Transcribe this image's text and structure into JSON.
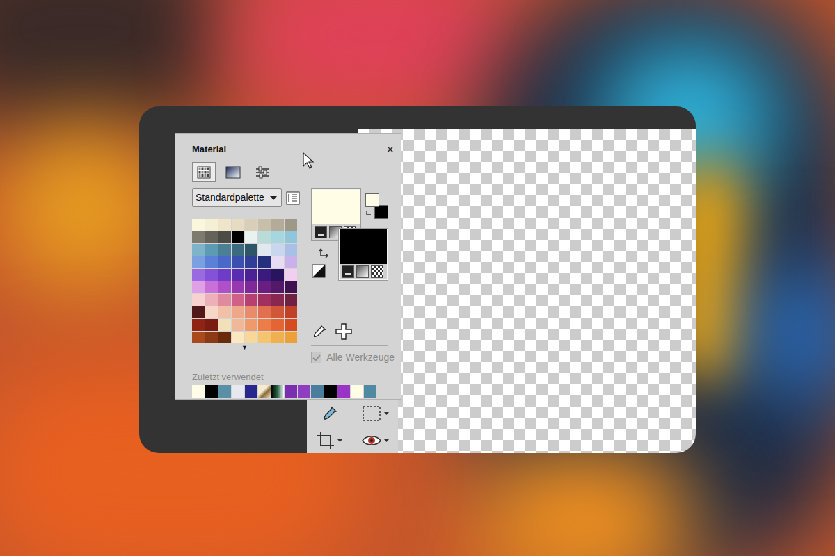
{
  "window": {
    "title": "Material",
    "close": "×"
  },
  "tabs": [
    {
      "kind": "swatches",
      "selected": true
    },
    {
      "kind": "gradient",
      "selected": false
    },
    {
      "kind": "properties",
      "selected": false
    }
  ],
  "palette": {
    "name": "Standardpalette",
    "scroll": "▼",
    "colors": [
      "#fbf7df",
      "#f5efd6",
      "#efe6c9",
      "#e6dcc2",
      "#d9cfb8",
      "#c8bfaa",
      "#b4ab98",
      "#9e9888",
      "#7e7a6e",
      "#65625a",
      "#4d4b46",
      "#000000",
      "#e8f2ee",
      "#b9dcd9",
      "#a6d7e0",
      "#8fc6dc",
      "#7fb3c9",
      "#5d9ab3",
      "#4a7f96",
      "#3c6a80",
      "#2f5568",
      "#e2e8f0",
      "#c8d6ee",
      "#a8c0e8",
      "#7aa0e0",
      "#5a80d8",
      "#4a68c8",
      "#3a50b0",
      "#2f3f98",
      "#24307c",
      "#e8dcf2",
      "#c9b2ec",
      "#9a6ae0",
      "#8452d8",
      "#6f3cc8",
      "#5a2cb0",
      "#4a2296",
      "#3a1a7c",
      "#2a1460",
      "#f0d0ee",
      "#e0a0e8",
      "#c870d8",
      "#b050c8",
      "#9838b0",
      "#802898",
      "#6a1e80",
      "#541868",
      "#401050",
      "#f6d2d0",
      "#eeb0b8",
      "#e08aa0",
      "#d06088",
      "#b84070",
      "#a03060",
      "#882850",
      "#702040",
      "#501818",
      "#f6d6c6",
      "#f2c0a6",
      "#eea888",
      "#e88c6c",
      "#e07050",
      "#d05838",
      "#c04028",
      "#902414",
      "#7a1c10",
      "#f2e0b8",
      "#f0b898",
      "#f09a6c",
      "#ec7c48",
      "#e46434",
      "#d44c20",
      "#a84a1c",
      "#8a3a14",
      "#6a2a0c",
      "#fbe8c0",
      "#f8d898",
      "#f4c470",
      "#f0b050",
      "#eca038"
    ]
  },
  "materials": {
    "foreground": "#fffde6",
    "background": "#000000"
  },
  "all_tools": {
    "label": "Alle Werkzeuge",
    "checked": true,
    "disabled": true
  },
  "recent": {
    "label": "Zuletzt verwendet",
    "items": [
      {
        "kind": "color",
        "colors": [
          "#fffde6"
        ]
      },
      {
        "kind": "color",
        "colors": [
          "#000000"
        ]
      },
      {
        "kind": "color",
        "colors": [
          "#5a8fa8"
        ]
      },
      {
        "kind": "color",
        "colors": [
          "#e8e8ef"
        ]
      },
      {
        "kind": "color",
        "colors": [
          "#28288c"
        ]
      },
      {
        "kind": "pattern",
        "colors": [
          "#f5ecd0",
          "#8a6a3a"
        ]
      },
      {
        "kind": "gradient",
        "colors": [
          "#000000",
          "#2a6a4a",
          "#ffffff"
        ]
      },
      {
        "kind": "color",
        "colors": [
          "#7a2fb0"
        ]
      },
      {
        "kind": "color",
        "colors": [
          "#8e3fc0"
        ]
      },
      {
        "kind": "color",
        "colors": [
          "#4a7e9c"
        ]
      },
      {
        "kind": "color",
        "colors": [
          "#000000"
        ]
      },
      {
        "kind": "color",
        "colors": [
          "#9a34c4"
        ]
      },
      {
        "kind": "color",
        "colors": [
          "#fffde6"
        ]
      },
      {
        "kind": "color",
        "colors": [
          "#4f8aa2"
        ]
      }
    ]
  }
}
